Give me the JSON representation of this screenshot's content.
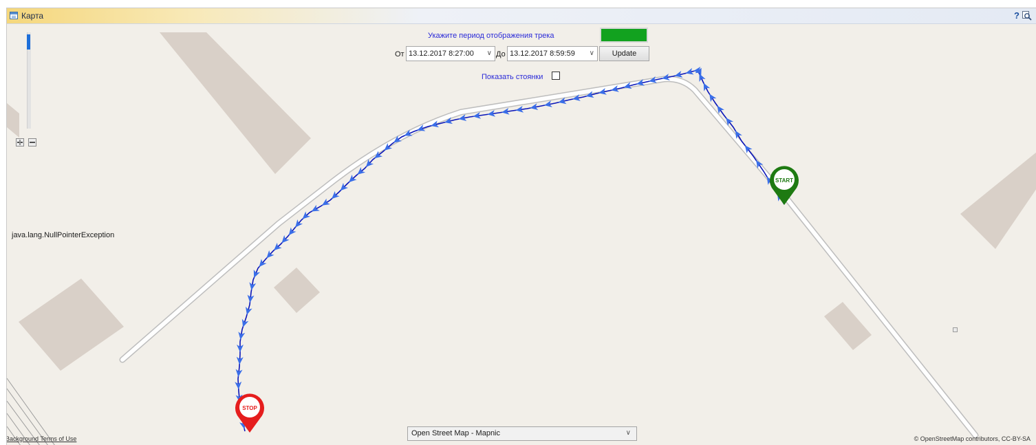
{
  "window": {
    "title": "Карта",
    "help_label": "?",
    "zoom_icon": "magnifier-icon"
  },
  "controls": {
    "period_label": "Укажите период отображения трека",
    "track_color": "#12a21f",
    "from_label": "От",
    "from_value": "13.12.2017 8:27:00",
    "to_label": "До",
    "to_value": "13.12.2017 8:59:59",
    "update_label": "Update",
    "stops_label": "Показать стоянки",
    "stops_checked": false
  },
  "map": {
    "error_text": "java.lang.NullPointerException",
    "layer_selected": "Open Street Map - Mapnic",
    "background_terms": "Background Terms of Use",
    "attribution": "© OpenStreetMap contributors, CC-BY-SA",
    "start_marker": {
      "label": "START",
      "color": "#1e7a12"
    },
    "stop_marker": {
      "label": "STOP",
      "color": "#e51d1d"
    },
    "track_line_color": "#0a14b8",
    "track_arrow_color": "#3a6ee8"
  }
}
